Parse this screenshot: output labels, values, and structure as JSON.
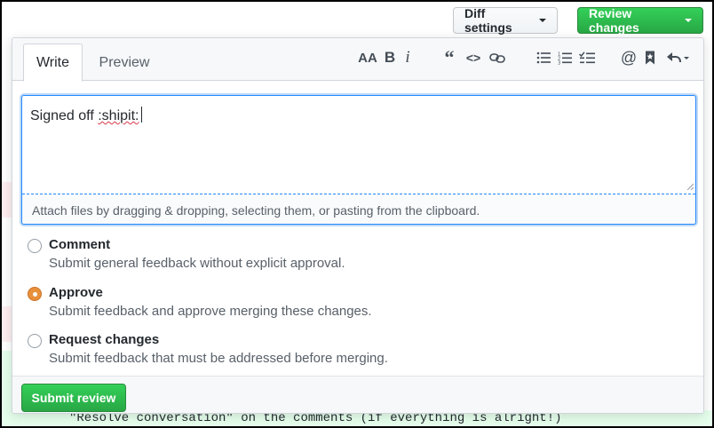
{
  "header": {
    "diff_settings_label": "Diff settings",
    "review_changes_label": "Review changes"
  },
  "tabs": {
    "write_label": "Write",
    "preview_label": "Preview"
  },
  "toolbar": {
    "heading_text": "AA",
    "bold_text": "B",
    "italic_text": "i",
    "quote_text": "66",
    "code_text": "<>",
    "mention_text": "@",
    "icons": [
      "heading-icon",
      "bold-icon",
      "italic-icon",
      "quote-icon",
      "code-icon",
      "link-icon",
      "bulleted-list-icon",
      "numbered-list-icon",
      "task-list-icon",
      "mention-icon",
      "reference-icon",
      "reply-icon"
    ]
  },
  "editor": {
    "text_prefix": "Signed off ",
    "text_emoji": ":shipit:",
    "attach_hint": "Attach files by dragging & dropping, selecting them, or pasting from the clipboard."
  },
  "options": [
    {
      "title": "Comment",
      "description": "Submit general feedback without explicit approval.",
      "selected": false
    },
    {
      "title": "Approve",
      "description": "Submit feedback and approve merging these changes.",
      "selected": true
    },
    {
      "title": "Request changes",
      "description": "Submit feedback that must be addressed before merging.",
      "selected": false
    }
  ],
  "footer": {
    "submit_label": "Submit review"
  },
  "background": {
    "code_line": "\"Resolve conversation\" on the comments (if everything is alright!)"
  },
  "colors": {
    "primary_green": "#28a745",
    "focus_blue": "#2188ff",
    "radio_selected": "#e8903a"
  }
}
